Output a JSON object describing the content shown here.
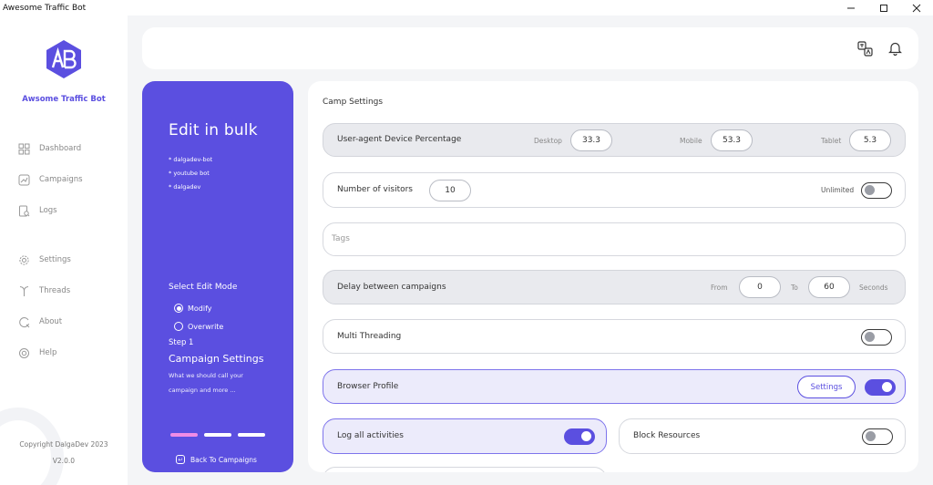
{
  "window": {
    "title": "Awesome Traffic Bot"
  },
  "sidebar": {
    "brand": "Awsome Traffic Bot",
    "items": [
      {
        "label": "Dashboard",
        "icon": "grid-icon"
      },
      {
        "label": "Campaigns",
        "icon": "chart-icon"
      },
      {
        "label": "Logs",
        "icon": "document-search-icon"
      },
      {
        "label": "Settings",
        "icon": "gear-icon"
      },
      {
        "label": "Threads",
        "icon": "branch-icon"
      },
      {
        "label": "About",
        "icon": "info-icon"
      },
      {
        "label": "Help",
        "icon": "lifebuoy-icon"
      }
    ],
    "copyright": "Copyright DalgaDev 2023",
    "version": "V2.0.0"
  },
  "panel": {
    "title": "Edit in bulk",
    "bots": [
      "* dalgadev-bot",
      "* youtube bot",
      "* dalgadev"
    ],
    "mode_title": "Select Edit Mode",
    "modes": [
      {
        "label": "Modify",
        "selected": true
      },
      {
        "label": "Overwrite",
        "selected": false
      }
    ],
    "step": "Step 1",
    "step_title": "Campaign Settings",
    "step_desc": "What we should call your campaign and more ...",
    "back": "Back To Campaigns",
    "progress_active_color": "#f08ce6"
  },
  "settings": {
    "title": "Camp Settings",
    "ua": {
      "label": "User-agent Device Percentage",
      "desktop_label": "Desktop",
      "desktop": "33.3",
      "mobile_label": "Mobile",
      "mobile": "53.3",
      "tablet_label": "Tablet",
      "tablet": "5.3"
    },
    "visitors": {
      "label": "Number of visitors",
      "value": "10",
      "unlimited_label": "Unlimited",
      "unlimited": false
    },
    "tags": {
      "placeholder": "Tags"
    },
    "delay": {
      "label": "Delay between campaigns",
      "from_label": "From",
      "from": "0",
      "to_label": "To",
      "to": "60",
      "unit": "Seconds"
    },
    "multithreading": {
      "label": "Multi Threading",
      "enabled": false
    },
    "browser_profile": {
      "label": "Browser Profile",
      "button": "Settings",
      "enabled": true
    },
    "log_all": {
      "label": "Log all activities",
      "enabled": true
    },
    "block_resources": {
      "label": "Block Resources",
      "enabled": false
    }
  },
  "colors": {
    "accent": "#5b4fe0",
    "background": "#f4f5f7"
  }
}
